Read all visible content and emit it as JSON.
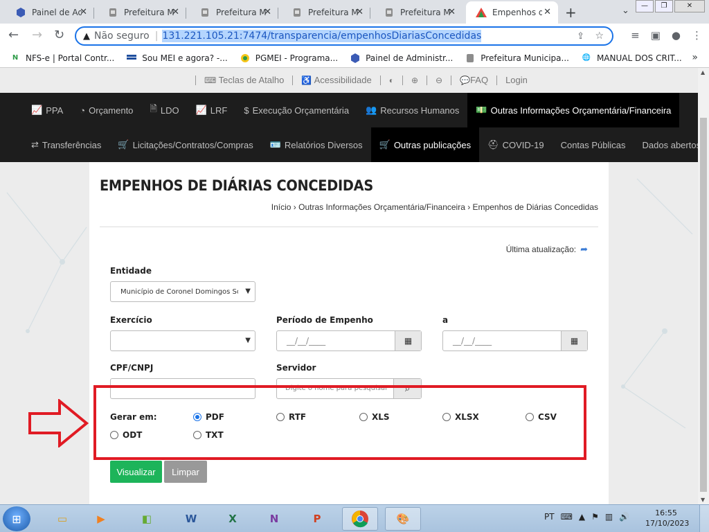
{
  "browser": {
    "tabs": [
      {
        "title": "Painel de Adm"
      },
      {
        "title": "Prefeitura Mu"
      },
      {
        "title": "Prefeitura Mu"
      },
      {
        "title": "Prefeitura Mu"
      },
      {
        "title": "Prefeitura Mu"
      },
      {
        "title": "Empenhos di"
      }
    ],
    "address": {
      "security": "Não seguro",
      "url": "131.221.105.21:7474/transparencia/empenhosDiariasConcedidas"
    },
    "bookmarks": [
      "NFS-e | Portal Contr...",
      "Sou MEI e agora? -...",
      "PGMEI - Programa...",
      "Painel de Administr...",
      "Prefeitura Municipa...",
      "MANUAL DOS CRIT..."
    ]
  },
  "utility_links": [
    "Teclas de Atalho",
    "Acessibilidade",
    "",
    "",
    "",
    "FAQ",
    "Login"
  ],
  "menu": {
    "row1": [
      "PPA",
      "Orçamento",
      "LDO",
      "LRF",
      "Execução Orçamentária",
      "Recursos Humanos",
      "Outras Informações Orçamentária/Financeira"
    ],
    "row2": [
      "Transferências",
      "Licitações/Contratos/Compras",
      "Relatórios Diversos",
      "Outras publicações",
      "COVID-19",
      "Contas Públicas",
      "Dados abertos"
    ]
  },
  "page": {
    "title": "EMPENHOS DE DIÁRIAS CONCEDIDAS",
    "breadcrumb": "Início › Outras Informações Orçamentária/Financeira › Empenhos de Diárias Concedidas",
    "last_update_label": "Última atualização:"
  },
  "form": {
    "entidade_label": "Entidade",
    "entidade_value": "Município de Coronel Domingos Soares",
    "exercicio_label": "Exercício",
    "exercicio_value": "",
    "periodo_label": "Período de Empenho",
    "ate_label": "a",
    "date_placeholder": "__/__/____",
    "cpf_label": "CPF/CNPJ",
    "servidor_label": "Servidor",
    "servidor_placeholder": "Digite o nome para pesquisar",
    "gerar_label": "Gerar em:",
    "formats": [
      "PDF",
      "RTF",
      "XLS",
      "XLSX",
      "CSV",
      "ODT",
      "TXT"
    ],
    "selected_format": "PDF",
    "visualizar": "Visualizar",
    "limpar": "Limpar"
  },
  "taskbar": {
    "lang": "PT",
    "time": "16:55",
    "date": "17/10/2023"
  }
}
